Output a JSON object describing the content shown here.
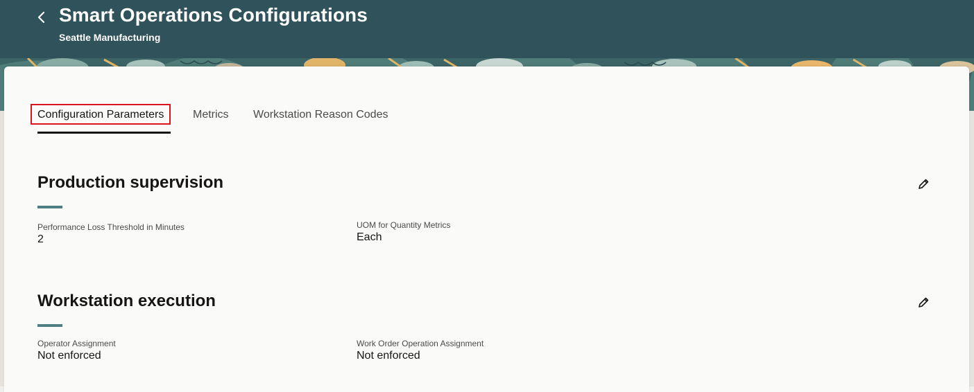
{
  "header": {
    "title": "Smart Operations Configurations",
    "subtitle": "Seattle Manufacturing",
    "background_color": "#30525a"
  },
  "tabs": [
    {
      "label": "Configuration Parameters",
      "selected": true
    },
    {
      "label": "Metrics",
      "selected": false
    },
    {
      "label": "Workstation Reason Codes",
      "selected": false
    }
  ],
  "sections": [
    {
      "title": "Production supervision",
      "fields": [
        {
          "label": "Performance Loss Threshold in Minutes",
          "value": "2"
        },
        {
          "label": "UOM for Quantity Metrics",
          "value": "Each"
        }
      ]
    },
    {
      "title": "Workstation execution",
      "fields": [
        {
          "label": "Operator Assignment",
          "value": "Not enforced"
        },
        {
          "label": "Work Order Operation Assignment",
          "value": "Not enforced"
        }
      ]
    }
  ],
  "icons": {
    "back": "chevron-left-icon",
    "edit": "pencil-icon"
  },
  "colors": {
    "accent_rule": "#4e7f80",
    "highlight_border": "#d9141d"
  }
}
